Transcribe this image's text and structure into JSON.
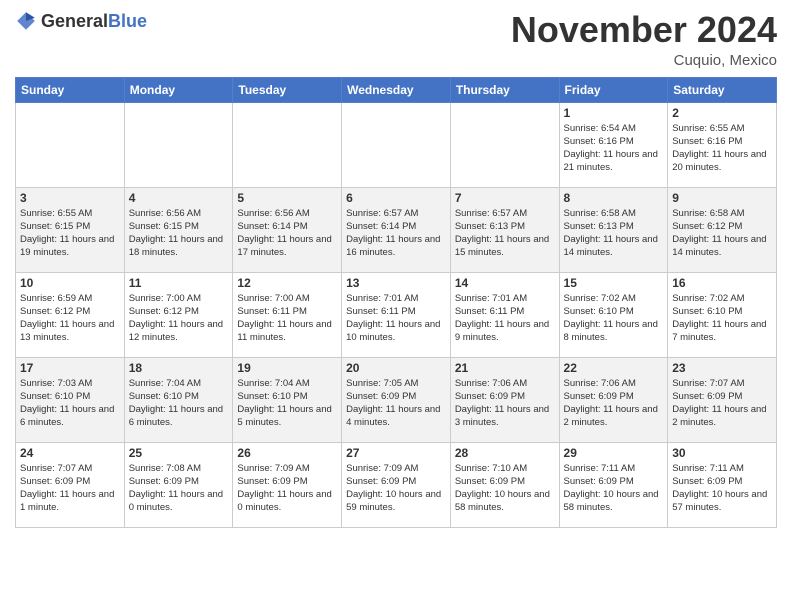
{
  "header": {
    "logo_general": "General",
    "logo_blue": "Blue",
    "month_title": "November 2024",
    "location": "Cuquio, Mexico"
  },
  "days_of_week": [
    "Sunday",
    "Monday",
    "Tuesday",
    "Wednesday",
    "Thursday",
    "Friday",
    "Saturday"
  ],
  "weeks": [
    [
      {
        "date": "",
        "info": ""
      },
      {
        "date": "",
        "info": ""
      },
      {
        "date": "",
        "info": ""
      },
      {
        "date": "",
        "info": ""
      },
      {
        "date": "",
        "info": ""
      },
      {
        "date": "1",
        "info": "Sunrise: 6:54 AM\nSunset: 6:16 PM\nDaylight: 11 hours and 21 minutes."
      },
      {
        "date": "2",
        "info": "Sunrise: 6:55 AM\nSunset: 6:16 PM\nDaylight: 11 hours and 20 minutes."
      }
    ],
    [
      {
        "date": "3",
        "info": "Sunrise: 6:55 AM\nSunset: 6:15 PM\nDaylight: 11 hours and 19 minutes."
      },
      {
        "date": "4",
        "info": "Sunrise: 6:56 AM\nSunset: 6:15 PM\nDaylight: 11 hours and 18 minutes."
      },
      {
        "date": "5",
        "info": "Sunrise: 6:56 AM\nSunset: 6:14 PM\nDaylight: 11 hours and 17 minutes."
      },
      {
        "date": "6",
        "info": "Sunrise: 6:57 AM\nSunset: 6:14 PM\nDaylight: 11 hours and 16 minutes."
      },
      {
        "date": "7",
        "info": "Sunrise: 6:57 AM\nSunset: 6:13 PM\nDaylight: 11 hours and 15 minutes."
      },
      {
        "date": "8",
        "info": "Sunrise: 6:58 AM\nSunset: 6:13 PM\nDaylight: 11 hours and 14 minutes."
      },
      {
        "date": "9",
        "info": "Sunrise: 6:58 AM\nSunset: 6:12 PM\nDaylight: 11 hours and 14 minutes."
      }
    ],
    [
      {
        "date": "10",
        "info": "Sunrise: 6:59 AM\nSunset: 6:12 PM\nDaylight: 11 hours and 13 minutes."
      },
      {
        "date": "11",
        "info": "Sunrise: 7:00 AM\nSunset: 6:12 PM\nDaylight: 11 hours and 12 minutes."
      },
      {
        "date": "12",
        "info": "Sunrise: 7:00 AM\nSunset: 6:11 PM\nDaylight: 11 hours and 11 minutes."
      },
      {
        "date": "13",
        "info": "Sunrise: 7:01 AM\nSunset: 6:11 PM\nDaylight: 11 hours and 10 minutes."
      },
      {
        "date": "14",
        "info": "Sunrise: 7:01 AM\nSunset: 6:11 PM\nDaylight: 11 hours and 9 minutes."
      },
      {
        "date": "15",
        "info": "Sunrise: 7:02 AM\nSunset: 6:10 PM\nDaylight: 11 hours and 8 minutes."
      },
      {
        "date": "16",
        "info": "Sunrise: 7:02 AM\nSunset: 6:10 PM\nDaylight: 11 hours and 7 minutes."
      }
    ],
    [
      {
        "date": "17",
        "info": "Sunrise: 7:03 AM\nSunset: 6:10 PM\nDaylight: 11 hours and 6 minutes."
      },
      {
        "date": "18",
        "info": "Sunrise: 7:04 AM\nSunset: 6:10 PM\nDaylight: 11 hours and 6 minutes."
      },
      {
        "date": "19",
        "info": "Sunrise: 7:04 AM\nSunset: 6:10 PM\nDaylight: 11 hours and 5 minutes."
      },
      {
        "date": "20",
        "info": "Sunrise: 7:05 AM\nSunset: 6:09 PM\nDaylight: 11 hours and 4 minutes."
      },
      {
        "date": "21",
        "info": "Sunrise: 7:06 AM\nSunset: 6:09 PM\nDaylight: 11 hours and 3 minutes."
      },
      {
        "date": "22",
        "info": "Sunrise: 7:06 AM\nSunset: 6:09 PM\nDaylight: 11 hours and 2 minutes."
      },
      {
        "date": "23",
        "info": "Sunrise: 7:07 AM\nSunset: 6:09 PM\nDaylight: 11 hours and 2 minutes."
      }
    ],
    [
      {
        "date": "24",
        "info": "Sunrise: 7:07 AM\nSunset: 6:09 PM\nDaylight: 11 hours and 1 minute."
      },
      {
        "date": "25",
        "info": "Sunrise: 7:08 AM\nSunset: 6:09 PM\nDaylight: 11 hours and 0 minutes."
      },
      {
        "date": "26",
        "info": "Sunrise: 7:09 AM\nSunset: 6:09 PM\nDaylight: 11 hours and 0 minutes."
      },
      {
        "date": "27",
        "info": "Sunrise: 7:09 AM\nSunset: 6:09 PM\nDaylight: 10 hours and 59 minutes."
      },
      {
        "date": "28",
        "info": "Sunrise: 7:10 AM\nSunset: 6:09 PM\nDaylight: 10 hours and 58 minutes."
      },
      {
        "date": "29",
        "info": "Sunrise: 7:11 AM\nSunset: 6:09 PM\nDaylight: 10 hours and 58 minutes."
      },
      {
        "date": "30",
        "info": "Sunrise: 7:11 AM\nSunset: 6:09 PM\nDaylight: 10 hours and 57 minutes."
      }
    ]
  ]
}
